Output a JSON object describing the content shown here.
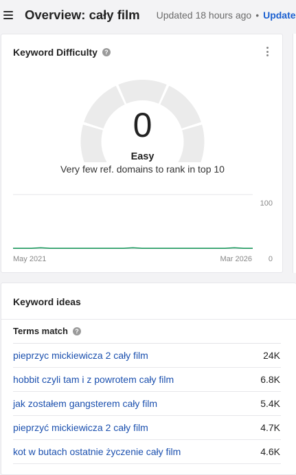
{
  "header": {
    "title": "Overview: cały film",
    "updated": "Updated 18 hours ago",
    "separator": "•",
    "update_link": "Update"
  },
  "keyword_difficulty": {
    "title": "Keyword Difficulty",
    "help": "?",
    "value": "0",
    "label": "Easy",
    "description": "Very few ref. domains to rank in top 10",
    "gauge_fraction": 0,
    "colors": {
      "gauge_track": "#ebebeb",
      "line": "#1e9a5f"
    }
  },
  "trend_chart": {
    "x_start": "May 2021",
    "x_end": "Mar 2026",
    "y_max": "100",
    "y_min": "0"
  },
  "chart_data": {
    "type": "line",
    "x": [
      "May 2021",
      "Mar 2026"
    ],
    "series": [
      {
        "values": [
          1,
          1,
          1,
          2,
          1,
          1,
          1,
          1,
          1,
          1,
          1,
          1,
          1,
          2,
          1,
          1,
          1,
          1,
          1,
          1,
          1,
          1,
          1,
          1,
          2,
          1,
          1
        ]
      }
    ],
    "ylim": [
      0,
      100
    ],
    "ytick_labels": [
      "0",
      "100"
    ],
    "xtick_labels": [
      "May 2021",
      "Mar 2026"
    ],
    "grid": true
  },
  "keyword_ideas": {
    "title": "Keyword ideas",
    "section": "Terms match",
    "help": "?",
    "rows": [
      {
        "keyword": "pieprzyc mickiewicza 2 cały film",
        "volume": "24K"
      },
      {
        "keyword": "hobbit czyli tam i z powrotem cały film",
        "volume": "6.8K"
      },
      {
        "keyword": "jak zostałem gangsterem cały film",
        "volume": "5.4K"
      },
      {
        "keyword": "pieprzyć mickiewicza 2 cały film",
        "volume": "4.7K"
      },
      {
        "keyword": "kot w butach ostatnie życzenie cały film",
        "volume": "4.6K"
      }
    ]
  }
}
